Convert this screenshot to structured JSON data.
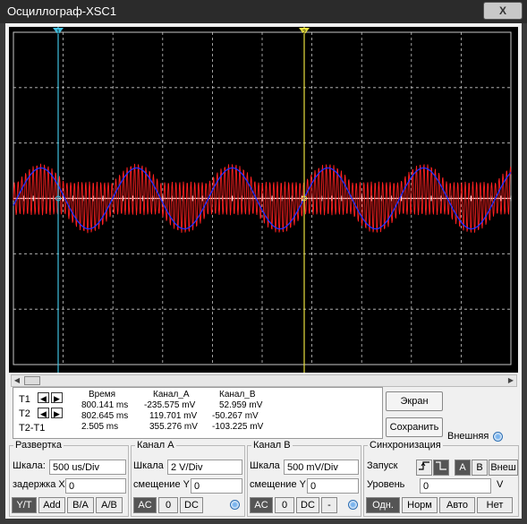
{
  "window": {
    "title": "Осциллограф-XSC1",
    "close_glyph": "X"
  },
  "cursor_markers": {
    "t1": "1",
    "t2": "2"
  },
  "measurements": {
    "rows": [
      "T1",
      "T2",
      "T2-T1"
    ],
    "headers": {
      "time": "Время",
      "channel_a": "Канал_A",
      "channel_b": "Канал_B"
    },
    "time": [
      "800.141 ms",
      "802.645 ms",
      "2.505 ms"
    ],
    "channel_a": [
      "-235.575 mV",
      "119.701 mV",
      "355.276 mV"
    ],
    "channel_b": [
      "52.959 mV",
      "-50.267 mV",
      "-103.225 mV"
    ]
  },
  "buttons": {
    "screen": "Экран",
    "save": "Сохранить",
    "external": "Внешняя"
  },
  "timebase": {
    "title": "Развертка",
    "scale_label": "Шкала:",
    "scale_value": "500 us/Div",
    "delay_label": "задержка X",
    "delay_value": "0",
    "modes": [
      "Y/T",
      "Add",
      "B/A",
      "A/B"
    ]
  },
  "channel_a": {
    "title": "Канал А",
    "scale_label": "Шкала",
    "scale_value": "2  V/Div",
    "offset_label": "смещение Y",
    "offset_value": "0",
    "coupling": [
      "AC",
      "0",
      "DC"
    ]
  },
  "channel_b": {
    "title": "Канал В",
    "scale_label": "Шкала",
    "scale_value": "500 mV/Div",
    "offset_label": "смещение Y",
    "offset_value": "0",
    "coupling": [
      "AC",
      "0",
      "DC",
      "-"
    ]
  },
  "trigger": {
    "title": "Синхронизация",
    "edge_label": "Запуск",
    "sources": [
      "A",
      "B",
      "Внеш"
    ],
    "level_label": "Уровень",
    "level_value": "0",
    "level_unit": "V",
    "modes": [
      "Одн.",
      "Норм",
      "Авто",
      "Нет"
    ]
  },
  "colors": {
    "channel_a_trace": "#ff2020",
    "channel_b_trace": "#2030ff",
    "cursor_t1": "#40c0e0",
    "cursor_t2": "#e8e040",
    "grid": "#c8c8c8",
    "screen_bg": "#000000"
  }
}
